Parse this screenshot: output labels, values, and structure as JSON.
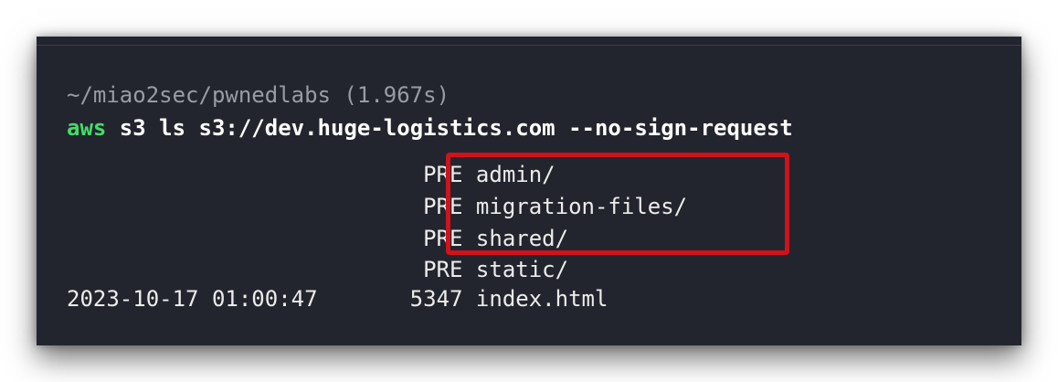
{
  "prompt": {
    "path": "~/miao2sec/pwnedlabs (1.967s)"
  },
  "command": {
    "keyword": "aws",
    "args": " s3 ls s3://dev.huge-logistics.com --no-sign-request"
  },
  "output": [
    "                           PRE admin/",
    "                           PRE migration-files/",
    "                           PRE shared/",
    "                           PRE static/",
    "2023-10-17 01:00:47       5347 index.html"
  ],
  "colors": {
    "background": "#23252e",
    "keyword": "#44dd66",
    "highlight": "#d0121b"
  }
}
